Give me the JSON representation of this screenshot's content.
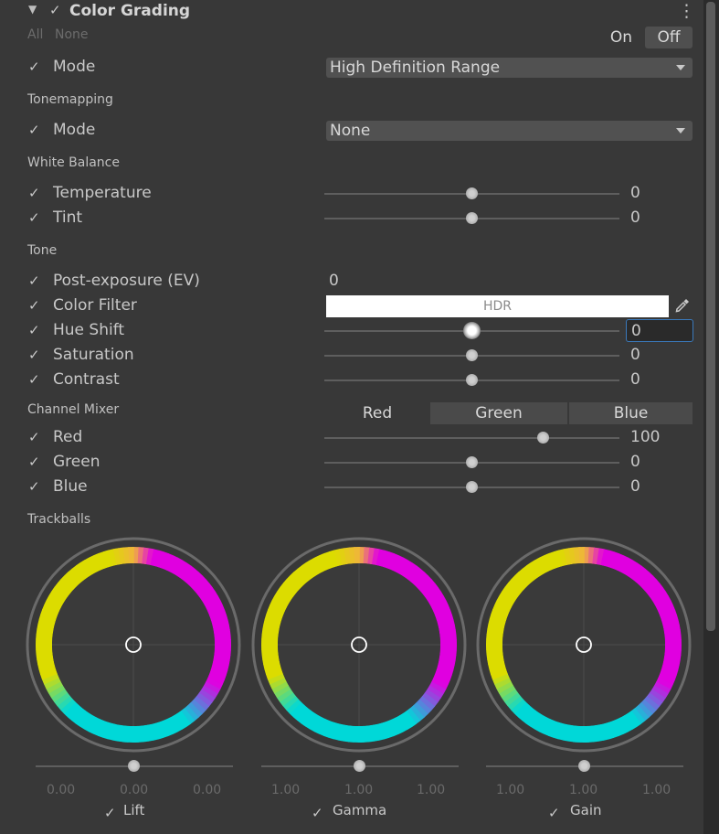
{
  "header": {
    "title": "Color Grading",
    "all_label": "All",
    "none_label": "None",
    "on_label": "On",
    "off_label": "Off"
  },
  "mode": {
    "label": "Mode",
    "value": "High Definition Range"
  },
  "tonemapping": {
    "section": "Tonemapping",
    "label": "Mode",
    "value": "None"
  },
  "white_balance": {
    "section": "White Balance",
    "rows": [
      {
        "label": "Temperature",
        "value": "0",
        "level": 0.5
      },
      {
        "label": "Tint",
        "value": "0",
        "level": 0.5
      }
    ]
  },
  "tone": {
    "section": "Tone",
    "post_exposure": {
      "label": "Post-exposure (EV)",
      "value": "0"
    },
    "color_filter": {
      "label": "Color Filter",
      "badge": "HDR"
    },
    "hue_shift": {
      "label": "Hue Shift",
      "value": "0",
      "level": 0.5
    },
    "saturation": {
      "label": "Saturation",
      "value": "0",
      "level": 0.5
    },
    "contrast": {
      "label": "Contrast",
      "value": "0",
      "level": 0.5
    }
  },
  "channel_mixer": {
    "section": "Channel Mixer",
    "tabs": [
      "Red",
      "Green",
      "Blue"
    ],
    "rows": [
      {
        "label": "Red",
        "value": "100",
        "level": 0.74
      },
      {
        "label": "Green",
        "value": "0",
        "level": 0.5
      },
      {
        "label": "Blue",
        "value": "0",
        "level": 0.5
      }
    ]
  },
  "trackballs": {
    "section": "Trackballs",
    "balls": [
      {
        "label": "Lift",
        "values": [
          "0.00",
          "0.00",
          "0.00"
        ]
      },
      {
        "label": "Gamma",
        "values": [
          "1.00",
          "1.00",
          "1.00"
        ]
      },
      {
        "label": "Gain",
        "values": [
          "1.00",
          "1.00",
          "1.00"
        ]
      }
    ]
  },
  "icons": {
    "foldout": "triangle-down-icon",
    "check": "checkmark-icon",
    "menu": "kebab-menu-icon",
    "picker": "eyedropper-icon",
    "dropdown": "chevron-down-icon"
  },
  "colors": {
    "background": "#383838",
    "yellow": "#dcdc00",
    "magenta": "#e000e0",
    "cyan": "#00d8d8",
    "focus": "#3a79bb"
  },
  "glyphs": {
    "check": "✓",
    "foldout": "▼",
    "menu": "⋮"
  }
}
